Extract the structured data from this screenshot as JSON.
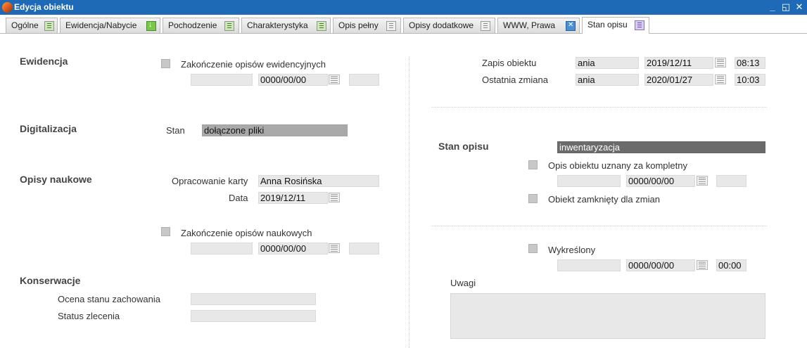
{
  "window": {
    "title": "Edycja obiektu",
    "minimize": "_",
    "restore": "◱",
    "close": "✕"
  },
  "tabs": [
    {
      "label": "Ogólne"
    },
    {
      "label": "Ewidencja/Nabycie"
    },
    {
      "label": "Pochodzenie"
    },
    {
      "label": "Charakterystyka"
    },
    {
      "label": "Opis pełny"
    },
    {
      "label": "Opisy dodatkowe"
    },
    {
      "label": "WWW, Prawa"
    },
    {
      "label": "Stan opisu"
    }
  ],
  "left": {
    "ewidencja": {
      "title": "Ewidencja",
      "checkbox_label": "Zakończenie opisów ewidencyjnych",
      "checked": false,
      "user": "",
      "date": "0000/00/00",
      "time": ""
    },
    "digitalizacja": {
      "title": "Digitalizacja",
      "stan_label": "Stan",
      "stan_value": "dołączone pliki"
    },
    "opisy_naukowe": {
      "title": "Opisy naukowe",
      "opracowanie_label": "Opracowanie karty",
      "opracowanie_value": "Anna Rosińska",
      "data_label": "Data",
      "data_value": "2019/12/11",
      "checkbox_label": "Zakończenie opisów naukowych",
      "checked": false,
      "user": "",
      "date": "0000/00/00",
      "time": ""
    },
    "konserwacje": {
      "title": "Konserwacje",
      "ocena_label": "Ocena stanu zachowania",
      "ocena_value": "",
      "status_label": "Status zlecenia",
      "status_value": ""
    }
  },
  "right": {
    "zapis": {
      "label": "Zapis obiektu",
      "user": "ania",
      "date": "2019/12/11",
      "time": "08:13"
    },
    "zmiana": {
      "label": "Ostatnia zmiana",
      "user": "ania",
      "date": "2020/01/27",
      "time": "10:03"
    },
    "stan_opisu": {
      "title": "Stan opisu",
      "value": "inwentaryzacja",
      "kompletny_label": "Opis obiektu uznany za kompletny",
      "kompletny_checked": false,
      "kompletny_user": "",
      "kompletny_date": "0000/00/00",
      "kompletny_time": "",
      "zamkniety_label": "Obiekt zamknięty dla zmian",
      "zamkniety_checked": false
    },
    "wykreslony": {
      "label": "Wykreślony",
      "checked": false,
      "user": "",
      "date": "0000/00/00",
      "time": "00:00"
    },
    "uwagi": {
      "label": "Uwagi",
      "value": ""
    }
  }
}
